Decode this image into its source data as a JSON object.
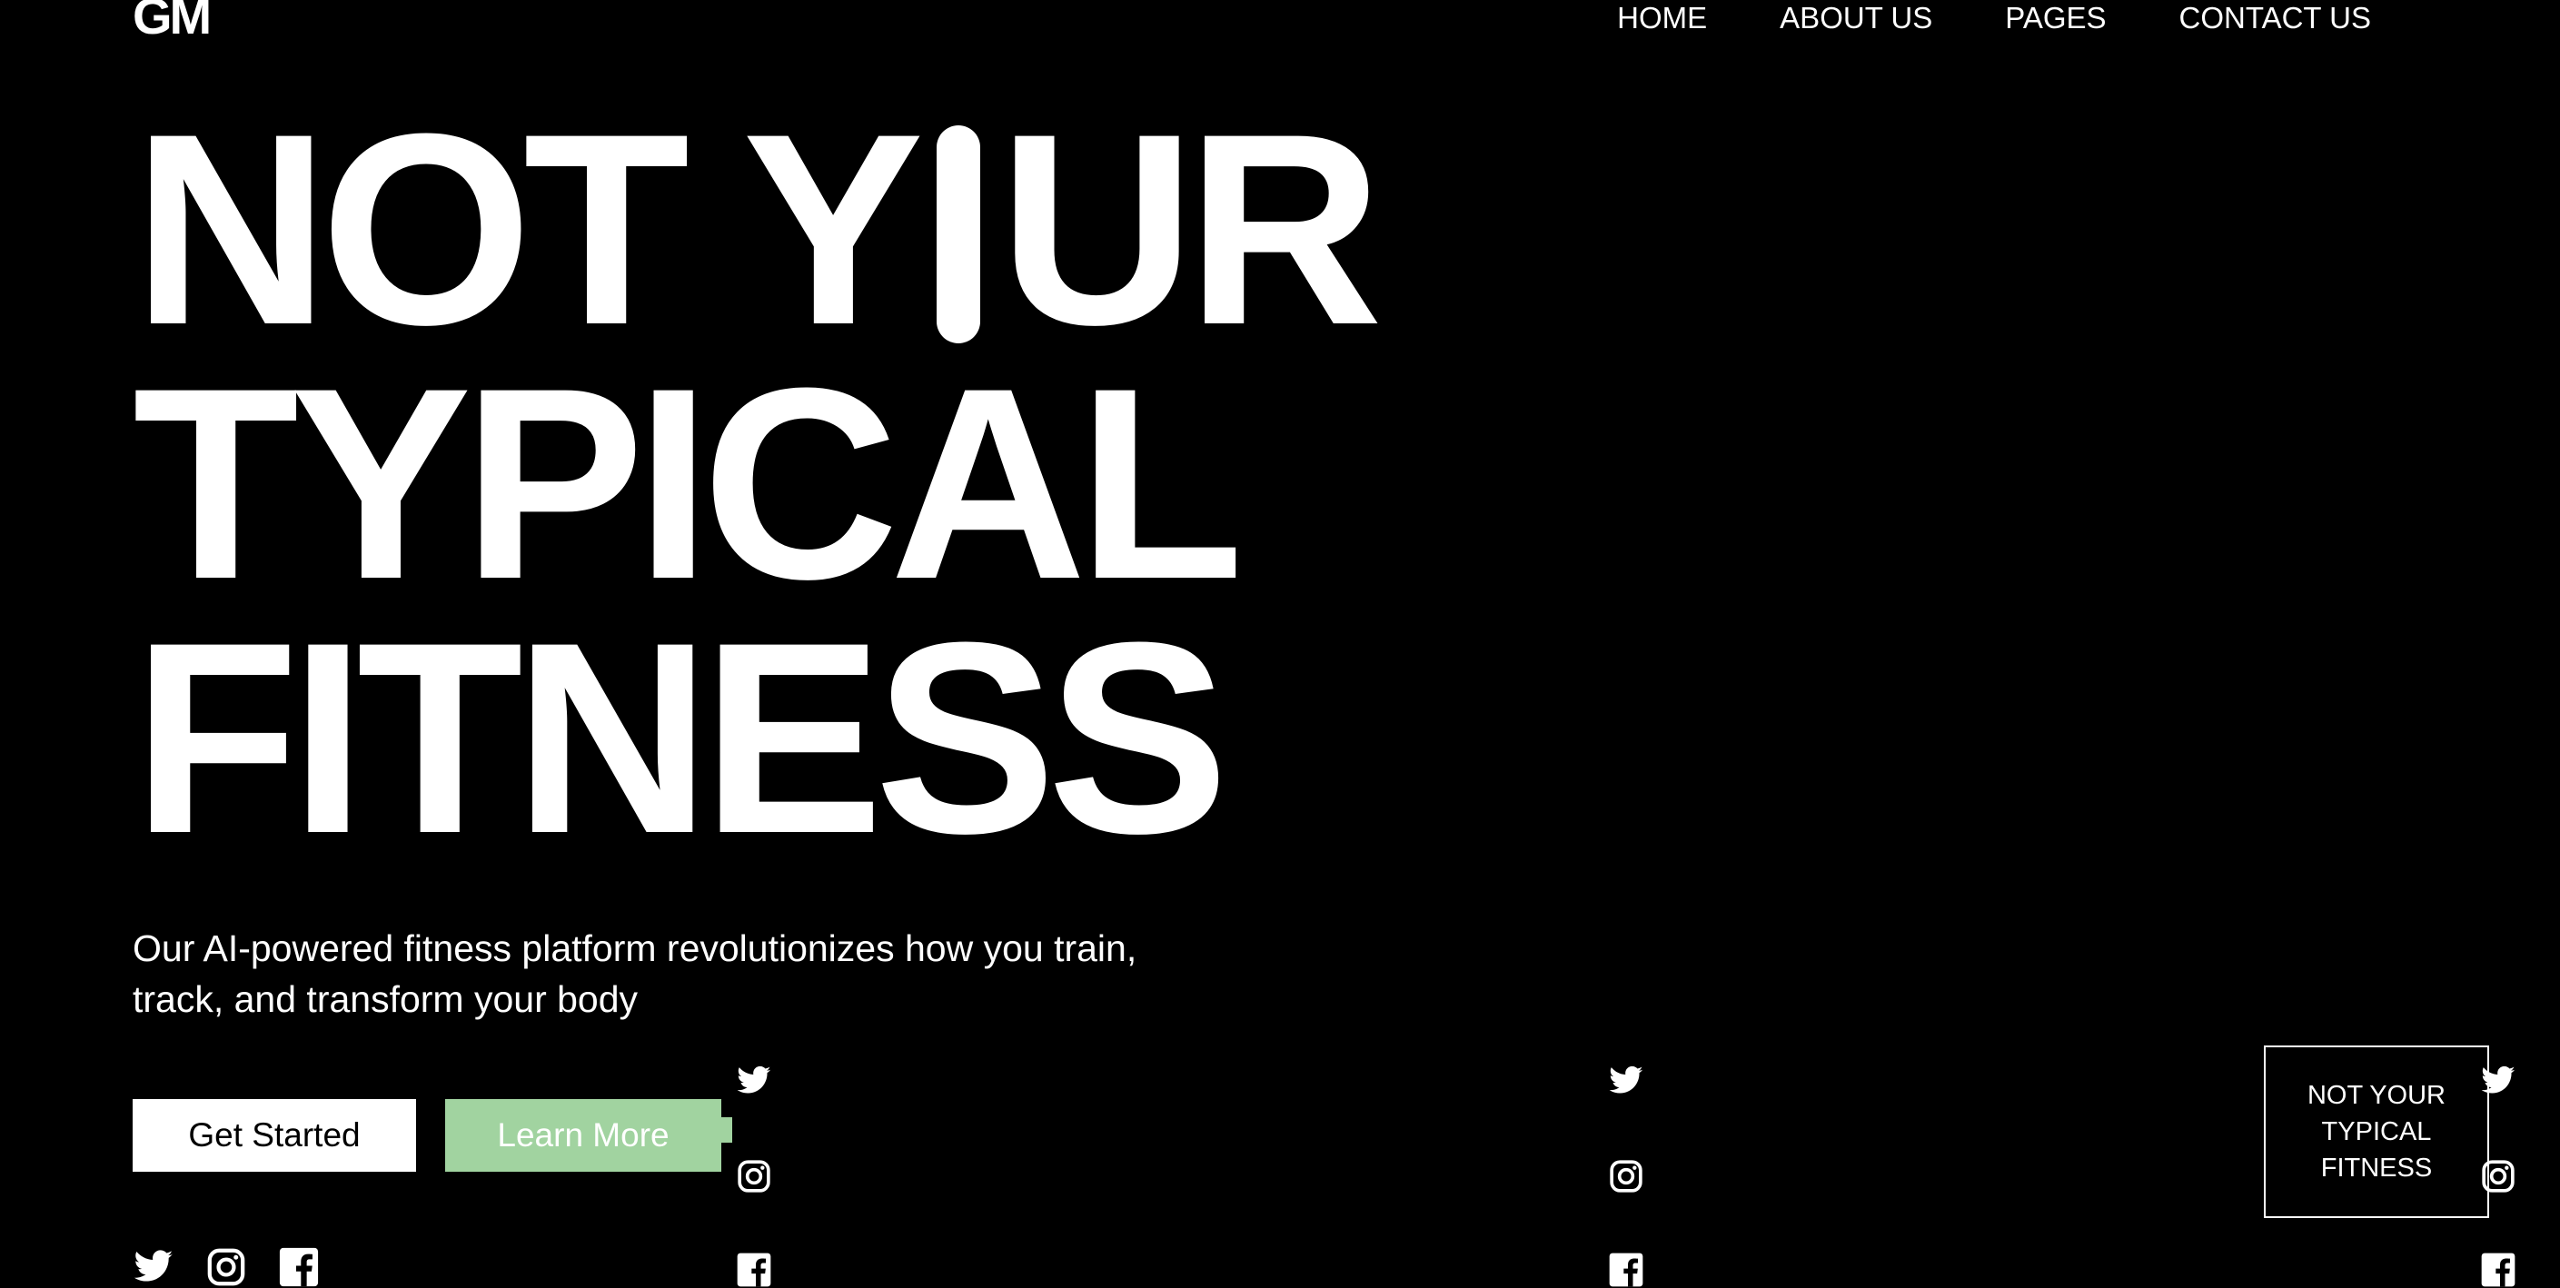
{
  "brand": {
    "logo": "GM"
  },
  "nav": {
    "items": [
      "HOME",
      "ABOUT US",
      "PAGES",
      "CONTACT US"
    ]
  },
  "hero": {
    "headline_line1_left": "NOT Y",
    "headline_line1_right": "UR",
    "headline_line2": "TYPICAL",
    "headline_line3": "FITNESS",
    "subtitle": "Our AI-powered fitness platform revolutionizes how you train, track, and transform your body",
    "primary_button": "Get Started",
    "secondary_button": "Learn More"
  },
  "card": {
    "text_lines": [
      "NOT YOUR",
      "TYPICAL",
      "FITNESS"
    ]
  },
  "icons": [
    "twitter-icon",
    "instagram-icon",
    "facebook-icon"
  ],
  "colors": {
    "background": "#000000",
    "text": "#ffffff",
    "accent_green": "#a1d3a0"
  }
}
